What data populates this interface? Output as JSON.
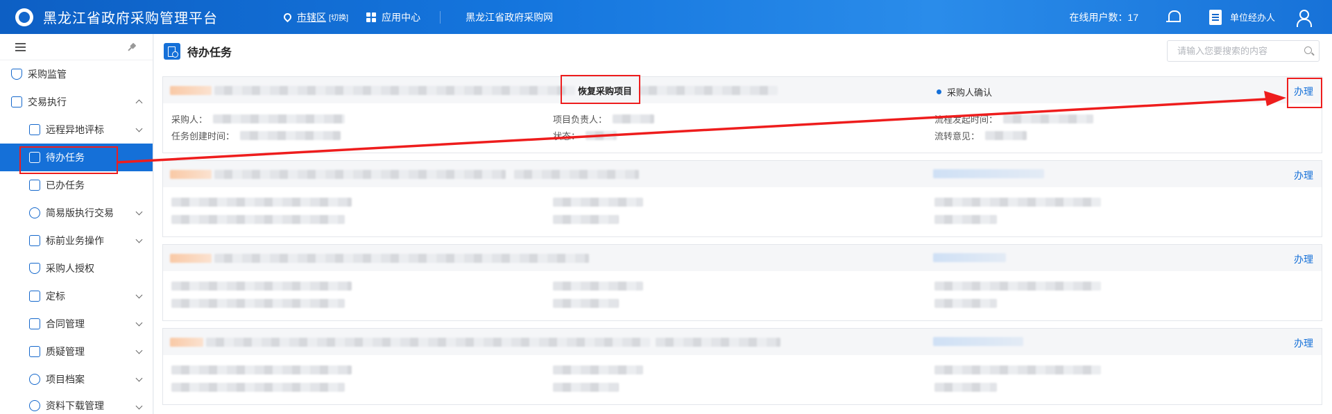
{
  "header": {
    "app_title": "黑龙江省政府采购管理平台",
    "region": "市辖区",
    "region_switch": "[切换]",
    "app_center": "应用中心",
    "site_link": "黑龙江省政府采购网",
    "online_users": "在线用户数：17",
    "unit_user": "单位经办人"
  },
  "sidebar": {
    "items": [
      {
        "label": "采购监管",
        "icon": "shield-check-icon"
      },
      {
        "label": "交易执行",
        "icon": "clipboard-icon"
      },
      {
        "label": "远程异地评标",
        "icon": "list-icon"
      },
      {
        "label": "待办任务",
        "icon": "todo-doc-icon"
      },
      {
        "label": "已办任务",
        "icon": "done-doc-icon"
      },
      {
        "label": "简易版执行交易",
        "icon": "simple-trade-icon"
      },
      {
        "label": "标前业务操作",
        "icon": "cart-icon"
      },
      {
        "label": "采购人授权",
        "icon": "shield-user-icon"
      },
      {
        "label": "定标",
        "icon": "award-icon"
      },
      {
        "label": "合同管理",
        "icon": "contract-icon"
      },
      {
        "label": "质疑管理",
        "icon": "question-cart-icon"
      },
      {
        "label": "项目档案",
        "icon": "archive-icon"
      },
      {
        "label": "资料下载管理",
        "icon": "link-icon"
      }
    ]
  },
  "page": {
    "title": "待办任务",
    "search_placeholder": "请输入您要搜索的内容"
  },
  "tasks": [
    {
      "title": "恢复采购项目",
      "status": "采购人确认",
      "action": "办理",
      "fields": {
        "purchaser_label": "采购人：",
        "owner_label": "项目负责人：",
        "flow_time_label": "流程发起时间：",
        "created_label": "任务创建时间：",
        "state_label": "状态：",
        "opinion_label": "流转意见："
      }
    },
    {
      "action": "办理"
    },
    {
      "action": "办理"
    },
    {
      "action": "办理"
    }
  ],
  "colors": {
    "brand": "#1570d8",
    "highlight": "#ee1d1d"
  }
}
